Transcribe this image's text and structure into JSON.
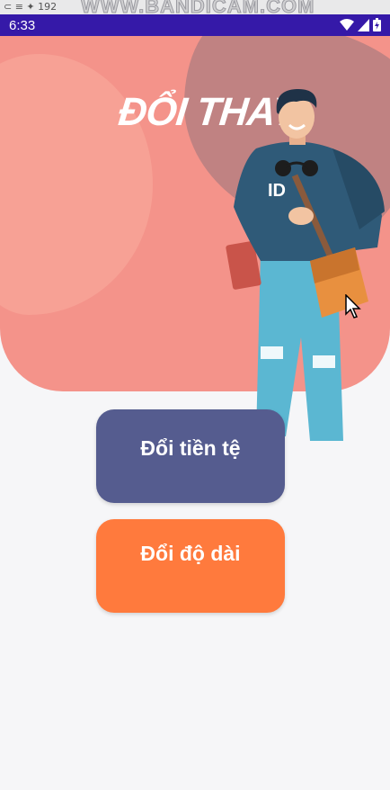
{
  "recorder": {
    "watermark": "WWW.BANDICAM.COM",
    "toolbar_text": "⊂ ≡ ✦ 192"
  },
  "status_bar": {
    "time": "6:33"
  },
  "header": {
    "title": "ĐỔI THAY"
  },
  "buttons": {
    "currency_label": "Đổi tiền tệ",
    "length_label": "Đổi độ dài"
  },
  "colors": {
    "status_bar": "#3519a8",
    "header": "#f4938a",
    "currency_button": "#555c8f",
    "length_button": "#ff7a3d"
  }
}
